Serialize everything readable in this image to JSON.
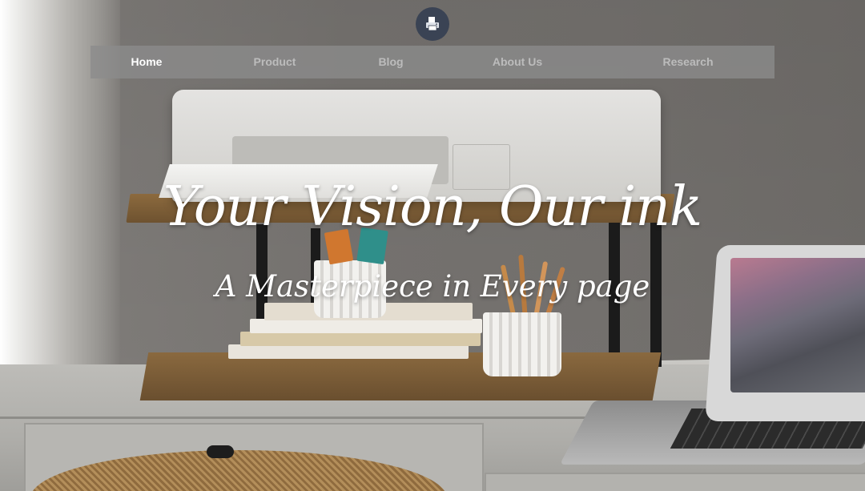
{
  "brand": {
    "logo_icon": "printer-icon",
    "logo_bg": "#3a4354"
  },
  "nav": {
    "items": [
      {
        "label": "Home",
        "active": true
      },
      {
        "label": "Product",
        "active": false
      },
      {
        "label": "Blog",
        "active": false
      },
      {
        "label": "About Us",
        "active": false
      },
      {
        "label": "Research",
        "active": false
      }
    ]
  },
  "hero": {
    "headline": "Your Vision, Our ink",
    "subheadline": "A Masterpiece in Every page",
    "background": "printer-on-wooden-shelf-photo"
  }
}
